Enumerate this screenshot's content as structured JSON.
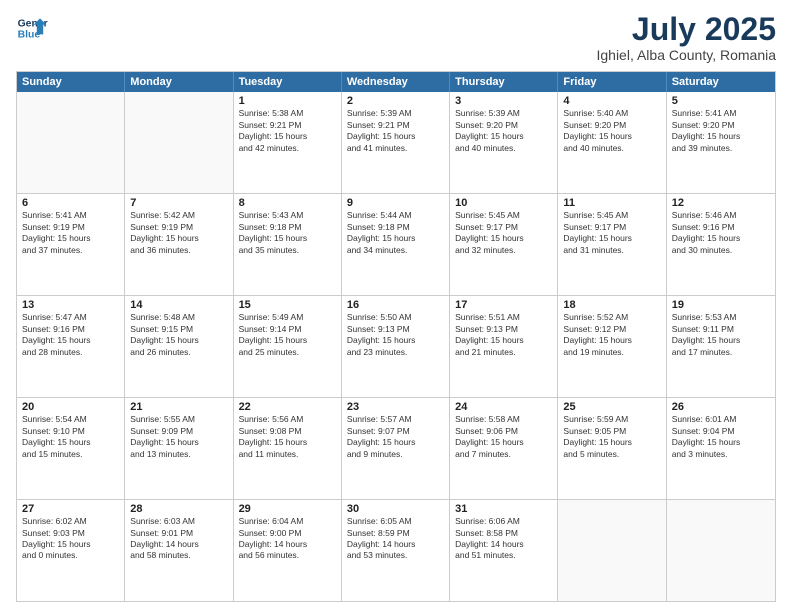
{
  "header": {
    "logo_line1": "General",
    "logo_line2": "Blue",
    "title": "July 2025",
    "subtitle": "Ighiel, Alba County, Romania"
  },
  "days_of_week": [
    "Sunday",
    "Monday",
    "Tuesday",
    "Wednesday",
    "Thursday",
    "Friday",
    "Saturday"
  ],
  "weeks": [
    [
      {
        "day": "",
        "text": ""
      },
      {
        "day": "",
        "text": ""
      },
      {
        "day": "1",
        "text": "Sunrise: 5:38 AM\nSunset: 9:21 PM\nDaylight: 15 hours\nand 42 minutes."
      },
      {
        "day": "2",
        "text": "Sunrise: 5:39 AM\nSunset: 9:21 PM\nDaylight: 15 hours\nand 41 minutes."
      },
      {
        "day": "3",
        "text": "Sunrise: 5:39 AM\nSunset: 9:20 PM\nDaylight: 15 hours\nand 40 minutes."
      },
      {
        "day": "4",
        "text": "Sunrise: 5:40 AM\nSunset: 9:20 PM\nDaylight: 15 hours\nand 40 minutes."
      },
      {
        "day": "5",
        "text": "Sunrise: 5:41 AM\nSunset: 9:20 PM\nDaylight: 15 hours\nand 39 minutes."
      }
    ],
    [
      {
        "day": "6",
        "text": "Sunrise: 5:41 AM\nSunset: 9:19 PM\nDaylight: 15 hours\nand 37 minutes."
      },
      {
        "day": "7",
        "text": "Sunrise: 5:42 AM\nSunset: 9:19 PM\nDaylight: 15 hours\nand 36 minutes."
      },
      {
        "day": "8",
        "text": "Sunrise: 5:43 AM\nSunset: 9:18 PM\nDaylight: 15 hours\nand 35 minutes."
      },
      {
        "day": "9",
        "text": "Sunrise: 5:44 AM\nSunset: 9:18 PM\nDaylight: 15 hours\nand 34 minutes."
      },
      {
        "day": "10",
        "text": "Sunrise: 5:45 AM\nSunset: 9:17 PM\nDaylight: 15 hours\nand 32 minutes."
      },
      {
        "day": "11",
        "text": "Sunrise: 5:45 AM\nSunset: 9:17 PM\nDaylight: 15 hours\nand 31 minutes."
      },
      {
        "day": "12",
        "text": "Sunrise: 5:46 AM\nSunset: 9:16 PM\nDaylight: 15 hours\nand 30 minutes."
      }
    ],
    [
      {
        "day": "13",
        "text": "Sunrise: 5:47 AM\nSunset: 9:16 PM\nDaylight: 15 hours\nand 28 minutes."
      },
      {
        "day": "14",
        "text": "Sunrise: 5:48 AM\nSunset: 9:15 PM\nDaylight: 15 hours\nand 26 minutes."
      },
      {
        "day": "15",
        "text": "Sunrise: 5:49 AM\nSunset: 9:14 PM\nDaylight: 15 hours\nand 25 minutes."
      },
      {
        "day": "16",
        "text": "Sunrise: 5:50 AM\nSunset: 9:13 PM\nDaylight: 15 hours\nand 23 minutes."
      },
      {
        "day": "17",
        "text": "Sunrise: 5:51 AM\nSunset: 9:13 PM\nDaylight: 15 hours\nand 21 minutes."
      },
      {
        "day": "18",
        "text": "Sunrise: 5:52 AM\nSunset: 9:12 PM\nDaylight: 15 hours\nand 19 minutes."
      },
      {
        "day": "19",
        "text": "Sunrise: 5:53 AM\nSunset: 9:11 PM\nDaylight: 15 hours\nand 17 minutes."
      }
    ],
    [
      {
        "day": "20",
        "text": "Sunrise: 5:54 AM\nSunset: 9:10 PM\nDaylight: 15 hours\nand 15 minutes."
      },
      {
        "day": "21",
        "text": "Sunrise: 5:55 AM\nSunset: 9:09 PM\nDaylight: 15 hours\nand 13 minutes."
      },
      {
        "day": "22",
        "text": "Sunrise: 5:56 AM\nSunset: 9:08 PM\nDaylight: 15 hours\nand 11 minutes."
      },
      {
        "day": "23",
        "text": "Sunrise: 5:57 AM\nSunset: 9:07 PM\nDaylight: 15 hours\nand 9 minutes."
      },
      {
        "day": "24",
        "text": "Sunrise: 5:58 AM\nSunset: 9:06 PM\nDaylight: 15 hours\nand 7 minutes."
      },
      {
        "day": "25",
        "text": "Sunrise: 5:59 AM\nSunset: 9:05 PM\nDaylight: 15 hours\nand 5 minutes."
      },
      {
        "day": "26",
        "text": "Sunrise: 6:01 AM\nSunset: 9:04 PM\nDaylight: 15 hours\nand 3 minutes."
      }
    ],
    [
      {
        "day": "27",
        "text": "Sunrise: 6:02 AM\nSunset: 9:03 PM\nDaylight: 15 hours\nand 0 minutes."
      },
      {
        "day": "28",
        "text": "Sunrise: 6:03 AM\nSunset: 9:01 PM\nDaylight: 14 hours\nand 58 minutes."
      },
      {
        "day": "29",
        "text": "Sunrise: 6:04 AM\nSunset: 9:00 PM\nDaylight: 14 hours\nand 56 minutes."
      },
      {
        "day": "30",
        "text": "Sunrise: 6:05 AM\nSunset: 8:59 PM\nDaylight: 14 hours\nand 53 minutes."
      },
      {
        "day": "31",
        "text": "Sunrise: 6:06 AM\nSunset: 8:58 PM\nDaylight: 14 hours\nand 51 minutes."
      },
      {
        "day": "",
        "text": ""
      },
      {
        "day": "",
        "text": ""
      }
    ]
  ]
}
